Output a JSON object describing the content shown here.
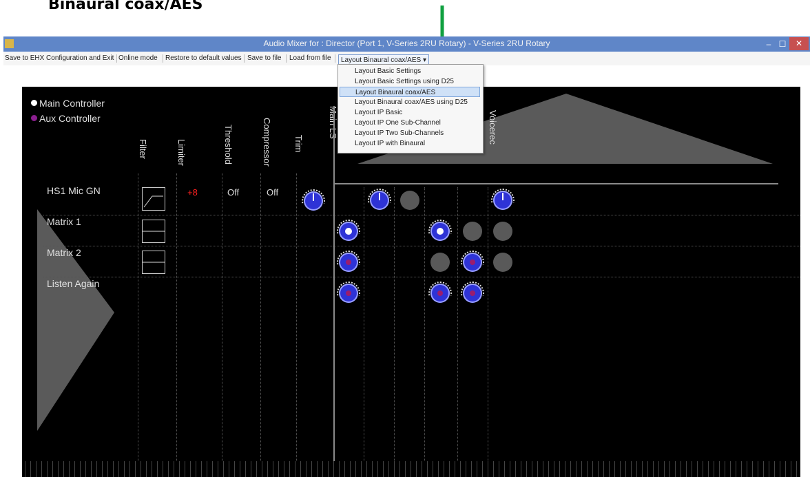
{
  "caption": "Binaural coax/AES",
  "window": {
    "title": "Audio Mixer for : Director    (Port 1, V-Series 2RU Rotary)  -  V-Series 2RU Rotary",
    "min": "–",
    "max": "☐",
    "close": "✕"
  },
  "menu": {
    "save_exit": "Save to EHX Configuration and Exit",
    "online": "Online mode",
    "restore": "Restore to default values",
    "save_file": "Save to file",
    "load_file": "Load from file",
    "layout_select": "Layout Binaural coax/AES ▾"
  },
  "dropdown": {
    "options": [
      "Layout Basic Settings",
      "Layout Basic Settings using D25",
      "Layout Binaural coax/AES",
      "Layout Binaural coax/AES using D25",
      "Layout IP Basic",
      "Layout IP One Sub-Channel",
      "Layout IP Two Sub-Channels",
      "Layout IP with Binaural"
    ],
    "selected": "Layout Binaural coax/AES"
  },
  "legend": {
    "main": "Main Controller",
    "aux": "Aux Controller",
    "main_color": "#ffffff",
    "aux_color": "#8b1f8f"
  },
  "columns": {
    "filter": "Filter",
    "limiter": "Limiter",
    "threshold": "Threshold",
    "compressor": "Compressor",
    "trim": "Trim",
    "main_ls": "Main LS",
    "voicerec": "Voicerec"
  },
  "rows": [
    {
      "label": "HS1 Mic GN",
      "limiter": "+8",
      "threshold": "Off",
      "compressor": "Off"
    },
    {
      "label": "Matrix 1"
    },
    {
      "label": "Matrix 2"
    },
    {
      "label": "Listen Again"
    }
  ],
  "colors": {
    "limiter_value": "#ff2020",
    "knob_blue": "#2e33d6",
    "knob_gray": "#595959",
    "pointer_arrow": "#10a040"
  }
}
